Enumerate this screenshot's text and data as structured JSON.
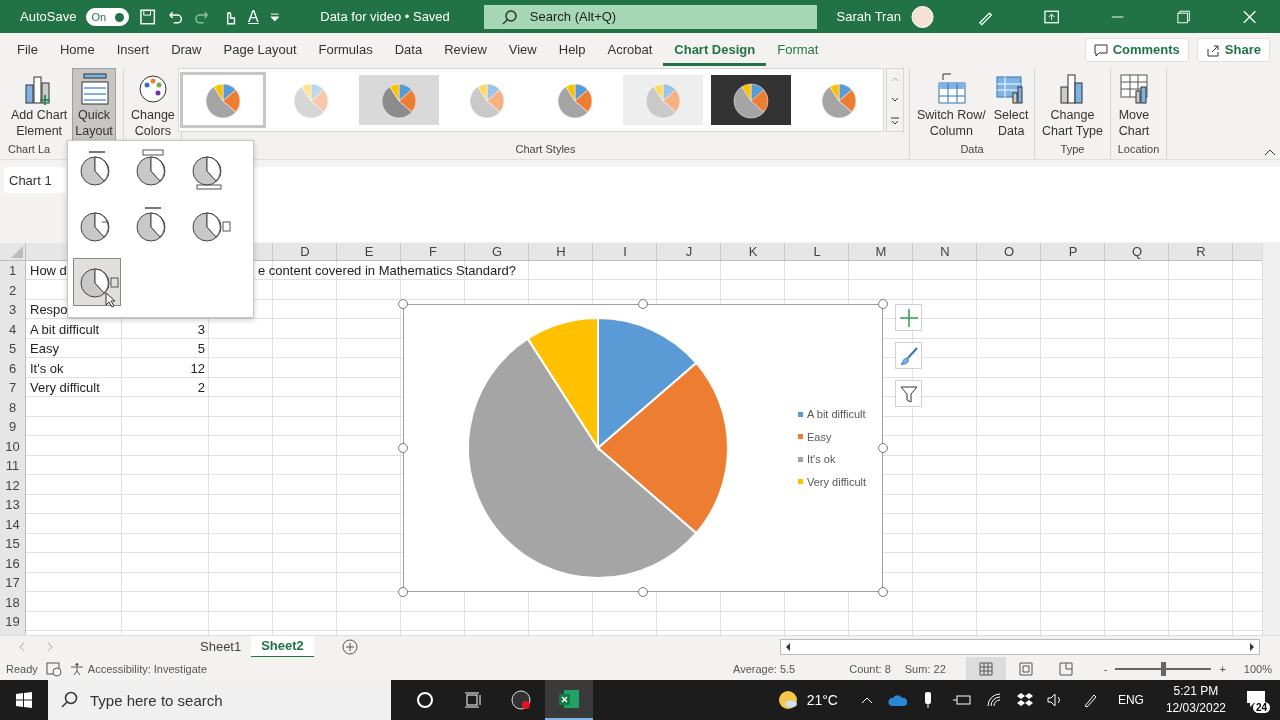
{
  "title_bar": {
    "autosave_label": "AutoSave",
    "autosave_toggle": {
      "label": "On",
      "on": true
    },
    "font_color_letter": "A",
    "document_title": "Data for video • Saved",
    "search": {
      "placeholder": "Search (Alt+Q)"
    },
    "user_name": "Sarah Tran"
  },
  "tabs": [
    {
      "label": "File",
      "selected": false,
      "kind": "normal"
    },
    {
      "label": "Home",
      "selected": false,
      "kind": "normal"
    },
    {
      "label": "Insert",
      "selected": false,
      "kind": "normal"
    },
    {
      "label": "Draw",
      "selected": false,
      "kind": "normal"
    },
    {
      "label": "Page Layout",
      "selected": false,
      "kind": "normal"
    },
    {
      "label": "Formulas",
      "selected": false,
      "kind": "normal"
    },
    {
      "label": "Data",
      "selected": false,
      "kind": "normal"
    },
    {
      "label": "Review",
      "selected": false,
      "kind": "normal"
    },
    {
      "label": "View",
      "selected": false,
      "kind": "normal"
    },
    {
      "label": "Help",
      "selected": false,
      "kind": "normal"
    },
    {
      "label": "Acrobat",
      "selected": false,
      "kind": "normal"
    },
    {
      "label": "Chart Design",
      "selected": true,
      "kind": "contextual"
    },
    {
      "label": "Format",
      "selected": false,
      "kind": "contextual"
    }
  ],
  "header_buttons": {
    "comments": "Comments",
    "share": "Share"
  },
  "ribbon": {
    "add_chart_element": [
      "Add Chart",
      "Element"
    ],
    "quick_layout": {
      "lines": [
        "Quick",
        "Layout"
      ],
      "selected": true
    },
    "change_colors": [
      "Change",
      "Colors"
    ],
    "chart_layouts_label": "Chart La",
    "chart_styles_label": "Chart Styles",
    "chart_styles": [
      {
        "kind": "plain",
        "selected": true
      },
      {
        "kind": "hatched",
        "selected": false
      },
      {
        "kind": "shaded",
        "selected": false
      },
      {
        "kind": "soft",
        "selected": false
      },
      {
        "kind": "plain",
        "selected": false
      },
      {
        "kind": "striped",
        "selected": false
      },
      {
        "kind": "dark",
        "selected": false
      },
      {
        "kind": "plain",
        "selected": false
      }
    ],
    "switch_row_column": [
      "Switch Row/",
      "Column"
    ],
    "select_data": [
      "Select",
      "Data"
    ],
    "data_label": "Data",
    "change_chart_type": [
      "Change",
      "Chart Type"
    ],
    "type_label": "Type",
    "move_chart": [
      "Move",
      "Chart"
    ],
    "location_label": "Location"
  },
  "quick_layouts": [
    {
      "kind": "title-percent",
      "selected": false
    },
    {
      "kind": "banner-percent",
      "selected": false
    },
    {
      "kind": "legend-bottom",
      "selected": false
    },
    {
      "kind": "labels",
      "selected": false
    },
    {
      "kind": "title-labels",
      "selected": false
    },
    {
      "kind": "full",
      "selected": false
    },
    {
      "kind": "legend-right",
      "selected": true
    }
  ],
  "name_box": "Chart 1",
  "columns": [
    "D",
    "E",
    "F",
    "G",
    "H",
    "I",
    "J",
    "K",
    "L",
    "M",
    "N",
    "O",
    "P",
    "Q",
    "R"
  ],
  "rows": [
    {
      "number": "1",
      "a": "How d",
      "overflow": "e content covered in Mathematics Standard?"
    },
    {
      "number": "2"
    },
    {
      "number": "3",
      "a": "Respo"
    },
    {
      "number": "4",
      "a": "A bit difficult",
      "b": "3"
    },
    {
      "number": "5",
      "a": "Easy",
      "b": "5"
    },
    {
      "number": "6",
      "a": "It's ok",
      "b": "12"
    },
    {
      "number": "7",
      "a": "Very difficult",
      "b": "2"
    },
    {
      "number": "8"
    },
    {
      "number": "9"
    },
    {
      "number": "10"
    },
    {
      "number": "11"
    },
    {
      "number": "12"
    },
    {
      "number": "13"
    },
    {
      "number": "14"
    },
    {
      "number": "15"
    },
    {
      "number": "16"
    },
    {
      "number": "17"
    },
    {
      "number": "18"
    },
    {
      "number": "19"
    }
  ],
  "chart": {
    "slices": [
      {
        "color": "#5b9bd5"
      },
      {
        "color": "#ed7d31"
      },
      {
        "color": "#a5a5a5"
      },
      {
        "color": "#ffc000"
      }
    ],
    "chart_data": {
      "type": "pie",
      "categories": [
        "A bit difficult",
        "Easy",
        "It's ok",
        "Very difficult"
      ],
      "values": [
        13.64,
        22.73,
        54.54,
        9.09
      ]
    }
  },
  "sheet_tabs": [
    {
      "label": "Sheet1",
      "selected": false
    },
    {
      "label": "Sheet2",
      "selected": true
    }
  ],
  "status_bar": {
    "ready": "Ready",
    "accessibility": "Accessibility: Investigate",
    "average": "Average: 5.5",
    "count": "Count: 8",
    "sum": "Sum: 22",
    "views": [
      {
        "kind": "normal",
        "selected": true
      },
      {
        "kind": "page",
        "selected": false
      },
      {
        "kind": "break",
        "selected": false
      }
    ],
    "zoom_minus": "-",
    "zoom_plus": "+",
    "zoom": {
      "level": 0.5
    },
    "zoom_text": "100%"
  },
  "taskbar": {
    "search_placeholder": "Type here to search",
    "temperature": "21°C",
    "language": "ENG",
    "time": "5:21 PM",
    "date": "12/03/2022",
    "notifications": "24"
  }
}
